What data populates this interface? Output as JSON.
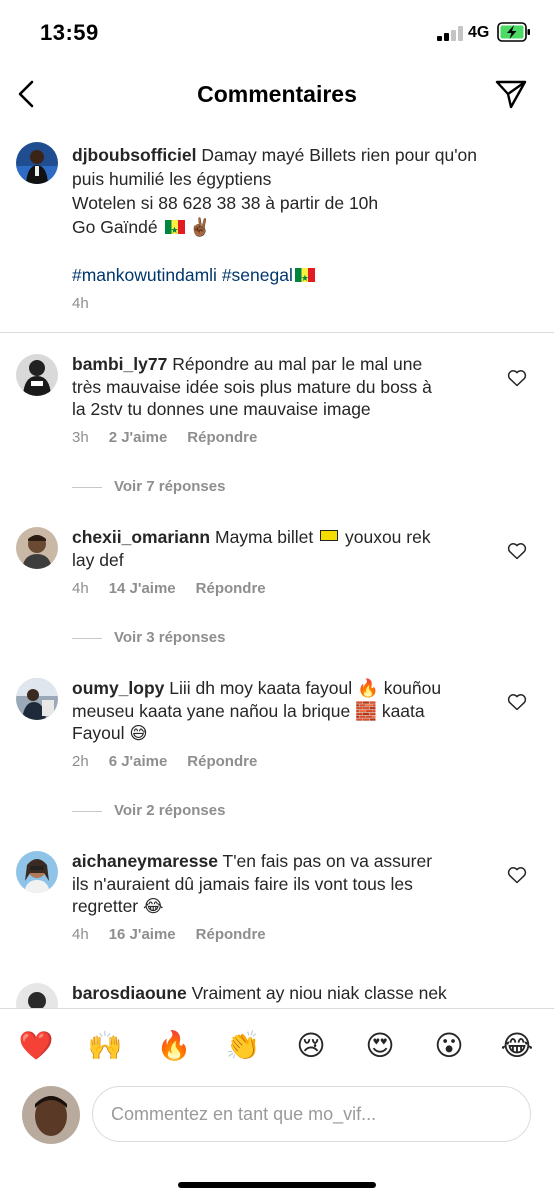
{
  "status_bar": {
    "time": "13:59",
    "network": "4G"
  },
  "header": {
    "title": "Commentaires"
  },
  "caption": {
    "username": "djboubsofficiel",
    "line1_text": "Damay mayé Billets rien pour qu'on",
    "line2": "puis  humilié les égyptiens",
    "line3": "Wotelen si 88 628 38 38 à partir de 10h",
    "line4": "Go Gaïndé",
    "line4_emoji": "✌🏾",
    "hashtag1": "#mankowutindamli",
    "hashtag2": "#senegal",
    "time": "4h"
  },
  "comments": [
    {
      "username": "bambi_ly77",
      "lines": [
        "Répondre au mal par le mal une",
        "très mauvaise idée sois plus mature du boss à",
        "la 2stv tu donnes une mauvaise image"
      ],
      "time": "3h",
      "likes": "2 J'aime",
      "reply": "Répondre",
      "view_replies": "Voir 7 réponses"
    },
    {
      "username": "chexii_omariann",
      "line1_a": "Mayma billet",
      "line1_b": "youxou rek",
      "line2": "lay def",
      "time": "4h",
      "likes": "14 J'aime",
      "reply": "Répondre",
      "view_replies": "Voir 3 réponses"
    },
    {
      "username": "oumy_lopy",
      "line1_a": "Liii dh moy kaata fayoul",
      "line1_emoji": "🔥",
      "line1_b": "kouñou",
      "line2_a": "meuseu kaata yane nañou la brique",
      "line2_emoji": "🧱",
      "line2_b": "kaata",
      "line3_a": "Fayoul",
      "line3_emoji": "😅",
      "time": "2h",
      "likes": "6 J'aime",
      "reply": "Répondre",
      "view_replies": "Voir 2 réponses"
    },
    {
      "username": "aichaneymaresse",
      "line1": "T'en fais pas on va assurer",
      "line2": "ils n'auraient dû jamais faire ils vont tous les",
      "line3_a": "regretter",
      "line3_emoji": "😂",
      "time": "4h",
      "likes": "16 J'aime",
      "reply": "Répondre"
    },
    {
      "username": "barosdiaoune",
      "line1": "Vraiment ay niou niak classe nek"
    }
  ],
  "reactions": [
    "❤️",
    "🙌",
    "🔥",
    "👏",
    "😢",
    "😍",
    "😮",
    "😂"
  ],
  "composer": {
    "placeholder": "Commentez en tant que mo_vif..."
  },
  "colors": {
    "text": "#262626",
    "secondary": "#8e8e8e",
    "hashtag": "#00376b",
    "divider": "#dbdbdb",
    "heart_red": "#ed4956"
  }
}
